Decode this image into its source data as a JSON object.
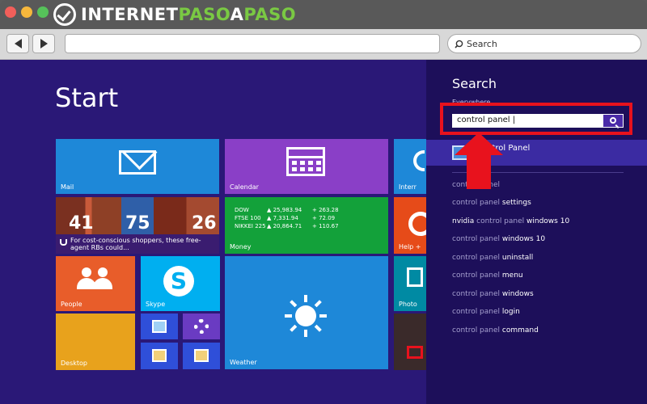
{
  "browser": {
    "brand_part1": "INTERNET",
    "brand_part2": "PASO",
    "brand_part3": "A",
    "brand_part4": "PASO",
    "search_placeholder": "Search"
  },
  "start": {
    "title": "Start",
    "tiles": {
      "mail": "Mail",
      "calendar": "Calendar",
      "internet": "Interr",
      "news_caption": "For cost-conscious shoppers, these free-agent RBs could...",
      "news_numbers": [
        "41",
        "75",
        "26"
      ],
      "money_label": "Money",
      "money_rows": [
        {
          "symbol": "DOW",
          "value": "▲ 25,983.94",
          "change": "+ 263.28"
        },
        {
          "symbol": "FTSE 100",
          "value": "▲ 7,331.94",
          "change": "+ 72.09"
        },
        {
          "symbol": "NIKKEI 225",
          "value": "▲ 20,864.71",
          "change": "+ 110.67"
        }
      ],
      "help": "Help +",
      "people": "People",
      "skype": "Skype",
      "skype_glyph": "S",
      "weather": "Weather",
      "photo": "Photo",
      "desktop": "Desktop"
    }
  },
  "charm": {
    "title": "Search",
    "scope": "Everywhere ⌄",
    "query": "control panel |",
    "top_result": "Control Panel",
    "suggestions": [
      {
        "dim": "control panel",
        "rest": ""
      },
      {
        "dim": "control panel",
        "rest": " settings"
      },
      {
        "dim": "",
        "rest": "nvidia ",
        "dim2": "control panel",
        "rest2": " windows 10"
      },
      {
        "dim": "control panel",
        "rest": " windows 10"
      },
      {
        "dim": "control panel",
        "rest": " uninstall"
      },
      {
        "dim": "control panel",
        "rest": " menu"
      },
      {
        "dim": "control panel",
        "rest": " windows"
      },
      {
        "dim": "control panel",
        "rest": " login"
      },
      {
        "dim": "control panel",
        "rest": " command"
      }
    ]
  },
  "colors": {
    "start_bg": "#2a1877",
    "charm_bg": "#1d0f5a",
    "highlight": "#e8121d",
    "brand_accent": "#7ac943"
  }
}
